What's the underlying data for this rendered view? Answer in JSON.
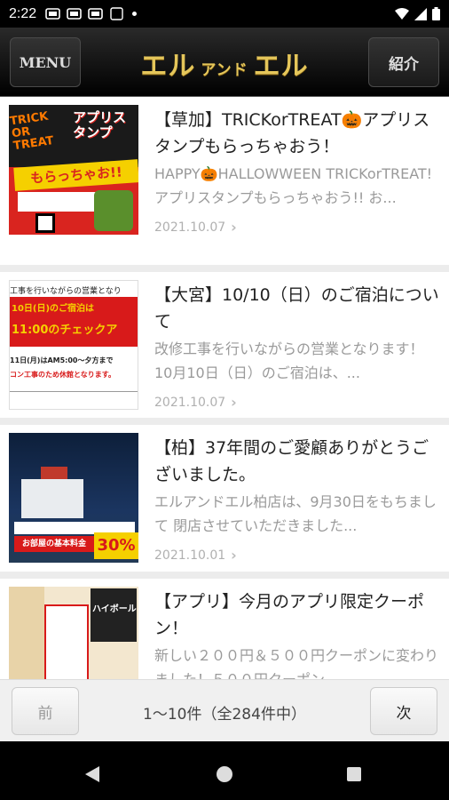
{
  "status_bar": {
    "time": "2:22"
  },
  "header": {
    "menu_label": "MENU",
    "logo_left": "エル",
    "logo_mid": "アンド",
    "logo_right": "エル",
    "intro_label": "紹介"
  },
  "items": [
    {
      "title": "【草加】TRICKorTREAT🎃アプリスタンプもらっちゃおう！",
      "excerpt": "HAPPY🎃HALLOWWEEN TRICKorTREAT! アプリスタンプもらっちゃおう!! お...",
      "date": "2021.10.07",
      "thumb": {
        "headline": "アプリスタンプ",
        "sub": "もらっちゃお!!",
        "corner": "TRICK OR TREAT"
      }
    },
    {
      "title": "【大宮】10/10（日）のご宿泊について",
      "excerpt": "改修工事を行いながらの営業となります！ 10月10日（日）のご宿泊は、...",
      "date": "2021.10.07",
      "thumb": {
        "line1": "工事を行いながらの営業となり",
        "line2": "10日(日)のご宿泊は",
        "line3": "11:00のチェックア",
        "line4": "11日(月)はAM5:00～夕方まで",
        "line5": "コン工事のため休館となります。"
      }
    },
    {
      "title": "【柏】37年間のご愛顧ありがとうございました。",
      "excerpt": "エルアンドエル柏店は、9月30日をもちまして 閉店させていただきました...",
      "date": "2021.10.01",
      "thumb": {
        "banner": "お部屋の基本料金",
        "percent": "30%"
      }
    },
    {
      "title": "【アプリ】今月のアプリ限定クーポン！",
      "excerpt": "新しい２００円＆５００円クーポンに変わりました！５００円クーポン",
      "date": "",
      "thumb": {
        "label": "ハイボール"
      }
    }
  ],
  "pager": {
    "prev_label": "前",
    "count": "1〜10件（全284件中）",
    "next_label": "次"
  },
  "colors": {
    "logo_gold": "#e5c65a",
    "header_bg": "#111111",
    "accent_red": "#d81a1a",
    "accent_yellow": "#f5d000"
  }
}
